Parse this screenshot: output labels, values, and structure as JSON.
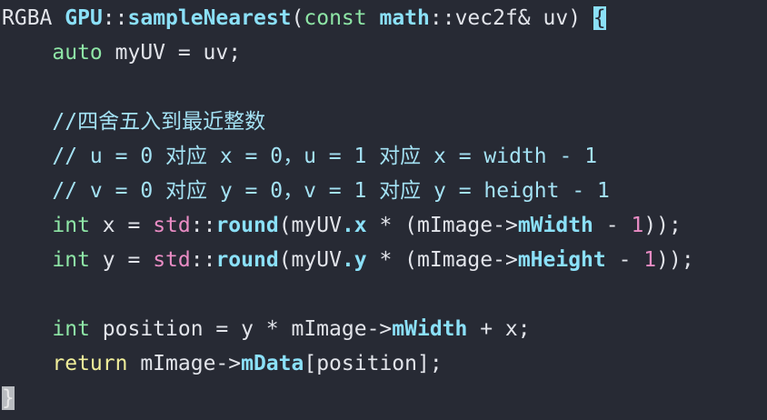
{
  "colors": {
    "background": "#272a34",
    "text": "#e2e4ea",
    "type_function": "#8be0f8",
    "keyword": "#8ee6a6",
    "return_keyword": "#f0ee9a",
    "namespace_number": "#e98cc4",
    "comment": "#a4e2f4"
  },
  "code_lines": [
    [
      [
        "RGBA ",
        "plain"
      ],
      [
        "GPU",
        "type"
      ],
      [
        "::",
        "plain"
      ],
      [
        "sampleNearest",
        "func"
      ],
      [
        "(",
        "plain"
      ],
      [
        "const",
        "kw"
      ],
      [
        " ",
        "plain"
      ],
      [
        "math",
        "type"
      ],
      [
        "::vec2f& uv) ",
        "plain"
      ],
      [
        "{",
        "brace-match"
      ]
    ],
    [
      [
        "    ",
        "plain"
      ],
      [
        "auto",
        "kw"
      ],
      [
        " myUV = uv;",
        "plain"
      ]
    ],
    [],
    [
      [
        "    //四舍五入到最近整数",
        "comment"
      ]
    ],
    [
      [
        "    // u = 0 对应 x = 0，u = 1 对应 x = width - 1",
        "comment"
      ]
    ],
    [
      [
        "    // v = 0 对应 y = 0，v = 1 对应 y = height - 1",
        "comment"
      ]
    ],
    [
      [
        "    ",
        "plain"
      ],
      [
        "int",
        "kw"
      ],
      [
        " x = ",
        "plain"
      ],
      [
        "std",
        "ns"
      ],
      [
        "::",
        "plain"
      ],
      [
        "round",
        "func"
      ],
      [
        "(myUV",
        "plain"
      ],
      [
        ".x",
        "member"
      ],
      [
        " * (mImage->",
        "plain"
      ],
      [
        "mWidth",
        "member"
      ],
      [
        " - ",
        "plain"
      ],
      [
        "1",
        "num"
      ],
      [
        "));",
        "plain"
      ]
    ],
    [
      [
        "    ",
        "plain"
      ],
      [
        "int",
        "kw"
      ],
      [
        " y = ",
        "plain"
      ],
      [
        "std",
        "ns"
      ],
      [
        "::",
        "plain"
      ],
      [
        "round",
        "func"
      ],
      [
        "(myUV",
        "plain"
      ],
      [
        ".y",
        "member"
      ],
      [
        " * (mImage->",
        "plain"
      ],
      [
        "mHeight",
        "member"
      ],
      [
        " - ",
        "plain"
      ],
      [
        "1",
        "num"
      ],
      [
        "));",
        "plain"
      ]
    ],
    [],
    [
      [
        "    ",
        "plain"
      ],
      [
        "int",
        "kw"
      ],
      [
        " position = y * mImage->",
        "plain"
      ],
      [
        "mWidth",
        "member"
      ],
      [
        " + x;",
        "plain"
      ]
    ],
    [
      [
        "    ",
        "plain"
      ],
      [
        "return",
        "kw-ret"
      ],
      [
        " mImage->",
        "plain"
      ],
      [
        "mData",
        "member"
      ],
      [
        "[position];",
        "plain"
      ]
    ],
    [
      [
        "}",
        "brace-close"
      ]
    ]
  ]
}
